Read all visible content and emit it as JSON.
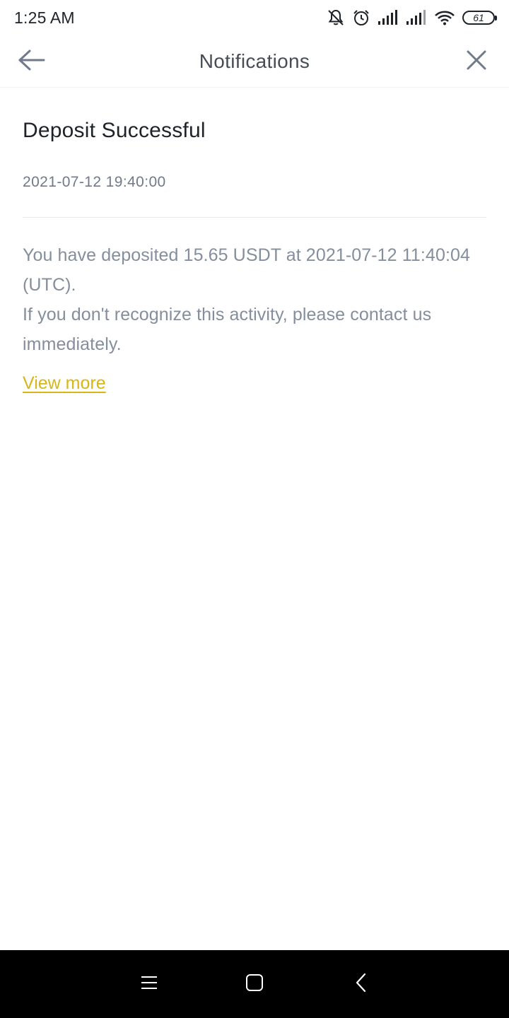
{
  "status_bar": {
    "time": "1:25 AM",
    "battery": "61",
    "icons": [
      "mute-alert-icon",
      "alarm-icon",
      "signal-icon",
      "signal-icon",
      "wifi-icon",
      "battery-icon"
    ]
  },
  "header": {
    "title": "Notifications",
    "back_icon": "arrow-left-icon",
    "close_icon": "close-icon"
  },
  "notification": {
    "title": "Deposit Successful",
    "time": "2021-07-12 19:40:00",
    "body_line1": "You have deposited 15.65 USDT at 2021-07-12 11:40:04 (UTC).",
    "body_line2": "If you don't recognize this activity, please contact us immediately.",
    "link_label": "View more",
    "link_color": "#d9b615"
  },
  "nav_bar": {
    "icons": [
      "menu-icon",
      "home-icon",
      "back-icon"
    ]
  }
}
